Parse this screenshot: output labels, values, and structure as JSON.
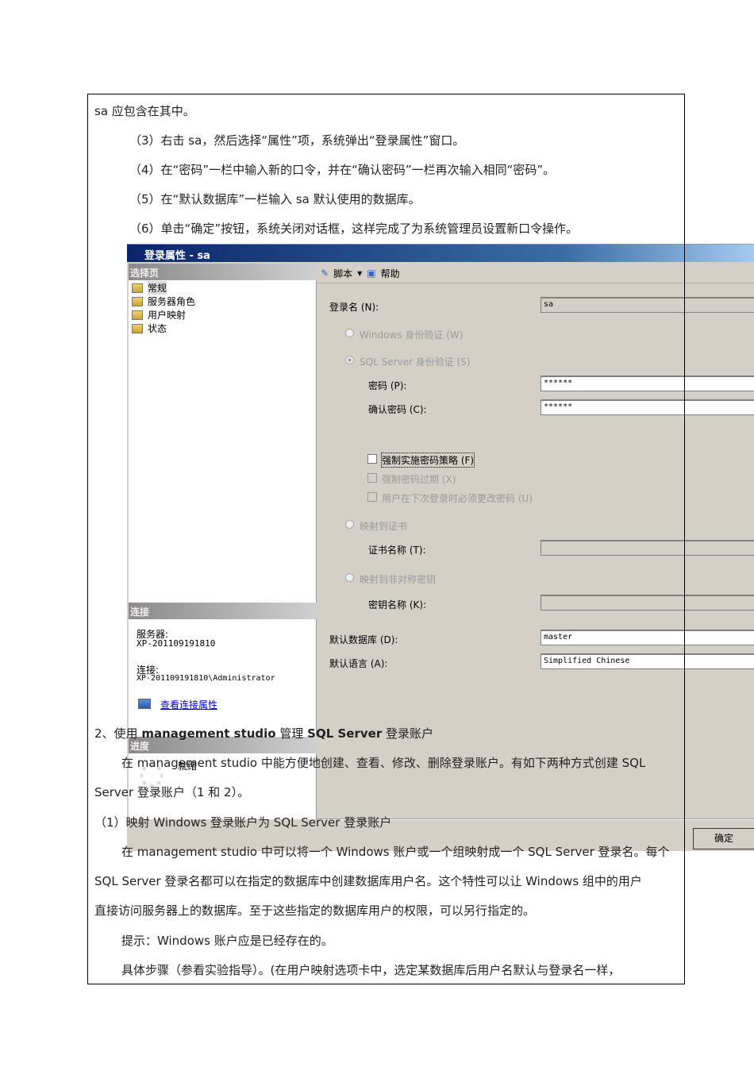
{
  "doc": {
    "lines_top": [
      "sa 应包含在其中。",
      "（3）右击 sa，然后选择“属性”项，系统弹出“登录属性”窗口。",
      "（4）在“密码”一栏中输入新的口令，并在“确认密码”一栏再次输入相同“密码”。",
      "（5）在“默认数据库”一栏输入 sa 默认使用的数据库。",
      "（6）单击“确定”按钮，系统关闭对话框，这样完成了为系统管理员设置新口令操作。"
    ],
    "section2_prefix": "2、使用 ",
    "section2_bold1": "management studio",
    "section2_mid": " 管理 ",
    "section2_bold2": "SQL Server",
    "section2_suffix": " 登录账户",
    "lines_bottom": [
      "在 management studio 中能方便地创建、查看、修改、删除登录账户。有如下两种方式创建 SQL",
      "Server 登录账户（1 和 2）。",
      "（1）映射 Windows 登录账户为 SQL Server 登录账户",
      "在 management studio 中可以将一个 Windows 账户或一个组映射成一个 SQL Server 登录名。每个",
      "SQL Server 登录名都可以在指定的数据库中创建数据库用户名。这个特性可以让 Windows 组中的用户",
      "直接访问服务器上的数据库。至于这些指定的数据库用户的权限，可以另行指定的。",
      "提示：Windows 账户应是已经存在的。",
      "具体步骤（参看实验指导）。(在用户映射选项卡中，选定某数据库后用户名默认与登录名一样，"
    ]
  },
  "dialog": {
    "title": "登录属性 - sa",
    "select_page": "选择页",
    "pages": [
      "常规",
      "服务器角色",
      "用户映射",
      "状态"
    ],
    "toolbar": {
      "script": "脚本",
      "help": "帮助"
    },
    "login_name_label": "登录名 (N):",
    "login_name": "sa",
    "windows_auth": "Windows 身份验证 (W)",
    "sql_auth": "SQL Server 身份验证 (S)",
    "password_label": "密码 (P):",
    "password": "******",
    "confirm_label": "确认密码 (C):",
    "confirm": "******",
    "enforce_policy": "强制实施密码策略 (F)",
    "enforce_expiry": "强制密码过期 (X)",
    "must_change": "用户在下次登录时必须更改密码 (U)",
    "map_cert": "映射到证书",
    "cert_label": "证书名称 (T):",
    "map_key": "映射到非对称密钥",
    "key_label": "密钥名称 (K):",
    "default_db_label": "默认数据库 (D):",
    "default_db": "master",
    "default_lang_label": "默认语言 (A):",
    "default_lang": "Simplified Chinese",
    "connection": "连接",
    "server_label": "服务器:",
    "server": "XP-201109191810",
    "conn_label": "连接:",
    "conn": "XP-201109191810\\Administrator",
    "view_props": "查看连接属性",
    "progress": "进度",
    "ready": "就绪",
    "ok": "确定"
  }
}
